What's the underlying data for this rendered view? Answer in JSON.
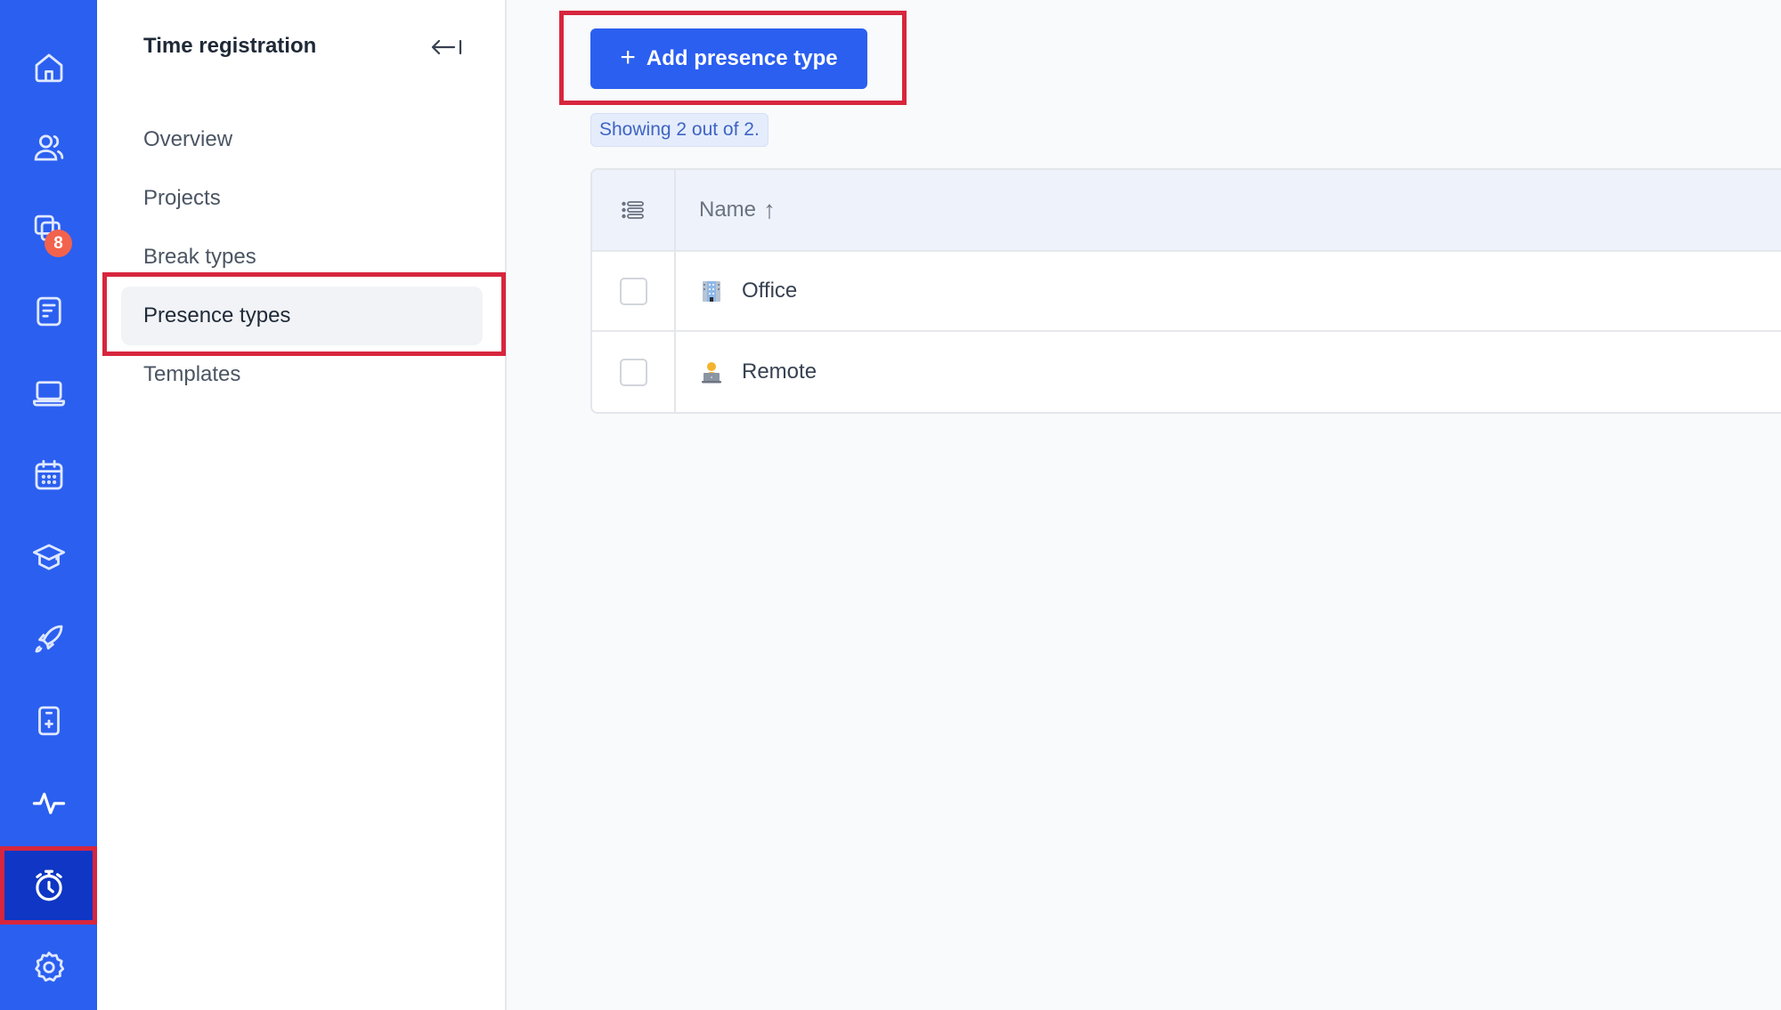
{
  "rail": {
    "items": [
      {
        "icon": "home-icon",
        "label": "Home"
      },
      {
        "icon": "users-icon",
        "label": "People"
      },
      {
        "icon": "stacked-cards-icon",
        "label": "Requests",
        "badge": "8"
      },
      {
        "icon": "document-icon",
        "label": "Documents"
      },
      {
        "icon": "laptop-icon",
        "label": "Devices"
      },
      {
        "icon": "calendar-icon",
        "label": "Calendar"
      },
      {
        "icon": "graduation-cap-icon",
        "label": "Learning"
      },
      {
        "icon": "rocket-icon",
        "label": "Onboarding"
      },
      {
        "icon": "medical-card-icon",
        "label": "Health"
      },
      {
        "icon": "pulse-icon",
        "label": "Activity"
      },
      {
        "icon": "stopwatch-icon",
        "label": "Time registration",
        "active": true
      },
      {
        "icon": "gear-icon",
        "label": "Settings"
      }
    ]
  },
  "subnav": {
    "title": "Time registration",
    "collapse_icon": "collapse-left-icon",
    "items": [
      {
        "label": "Overview"
      },
      {
        "label": "Projects"
      },
      {
        "label": "Break types"
      },
      {
        "label": "Presence types",
        "active": true
      },
      {
        "label": "Templates"
      }
    ]
  },
  "main": {
    "add_button": {
      "icon": "plus-icon",
      "label": "Add presence type"
    },
    "count_text": "Showing 2 out of 2.",
    "table": {
      "columns_icon": "column-settings-icon",
      "header": {
        "name": "Name",
        "sort": "↑"
      },
      "rows": [
        {
          "icon": "office-building-icon",
          "name": "Office",
          "checked": false
        },
        {
          "icon": "person-laptop-icon",
          "name": "Remote",
          "checked": false
        }
      ]
    }
  },
  "colors": {
    "brand": "#2b5ff0",
    "rail_active": "#0f36c4",
    "badge": "#f2624c",
    "highlight": "#d7263d"
  }
}
